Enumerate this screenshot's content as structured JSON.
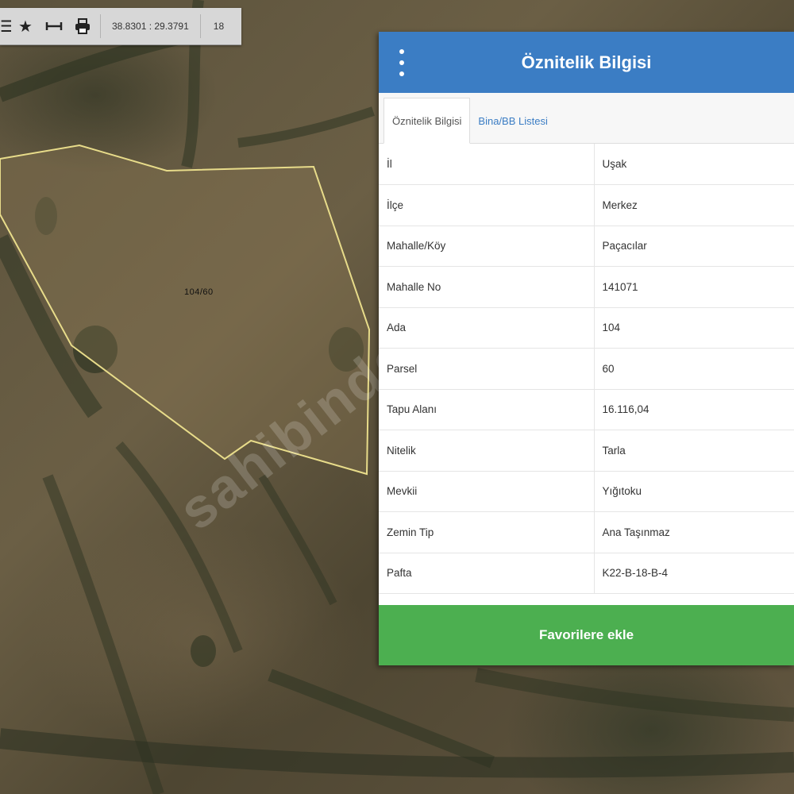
{
  "toolbar": {
    "icons": [
      "menu-icon",
      "star-icon",
      "measure-icon",
      "print-icon"
    ],
    "coordinates": "38.8301 : 29.3791",
    "zoom_level": "18"
  },
  "map": {
    "parcel_label": "104/60",
    "watermark": "sahibinden",
    "parcel_outline_color": "#e8dc8a"
  },
  "panel": {
    "title": "Öznitelik Bilgisi",
    "header_color": "#3b7dc4",
    "tabs": [
      {
        "label": "Öznitelik Bilgisi",
        "active": true
      },
      {
        "label": "Bina/BB Listesi",
        "active": false
      }
    ],
    "rows": [
      {
        "key": "İl",
        "value": "Uşak"
      },
      {
        "key": "İlçe",
        "value": "Merkez"
      },
      {
        "key": "Mahalle/Köy",
        "value": "Paçacılar"
      },
      {
        "key": "Mahalle No",
        "value": "141071"
      },
      {
        "key": "Ada",
        "value": "104"
      },
      {
        "key": "Parsel",
        "value": "60"
      },
      {
        "key": "Tapu Alanı",
        "value": "16.116,04"
      },
      {
        "key": "Nitelik",
        "value": "Tarla"
      },
      {
        "key": "Mevkii",
        "value": "Yığıtoku"
      },
      {
        "key": "Zemin Tip",
        "value": "Ana Taşınmaz"
      },
      {
        "key": "Pafta",
        "value": "K22-B-18-B-4"
      }
    ],
    "favorite_button": "Favorilere ekle",
    "favorite_button_color": "#4caf50"
  }
}
